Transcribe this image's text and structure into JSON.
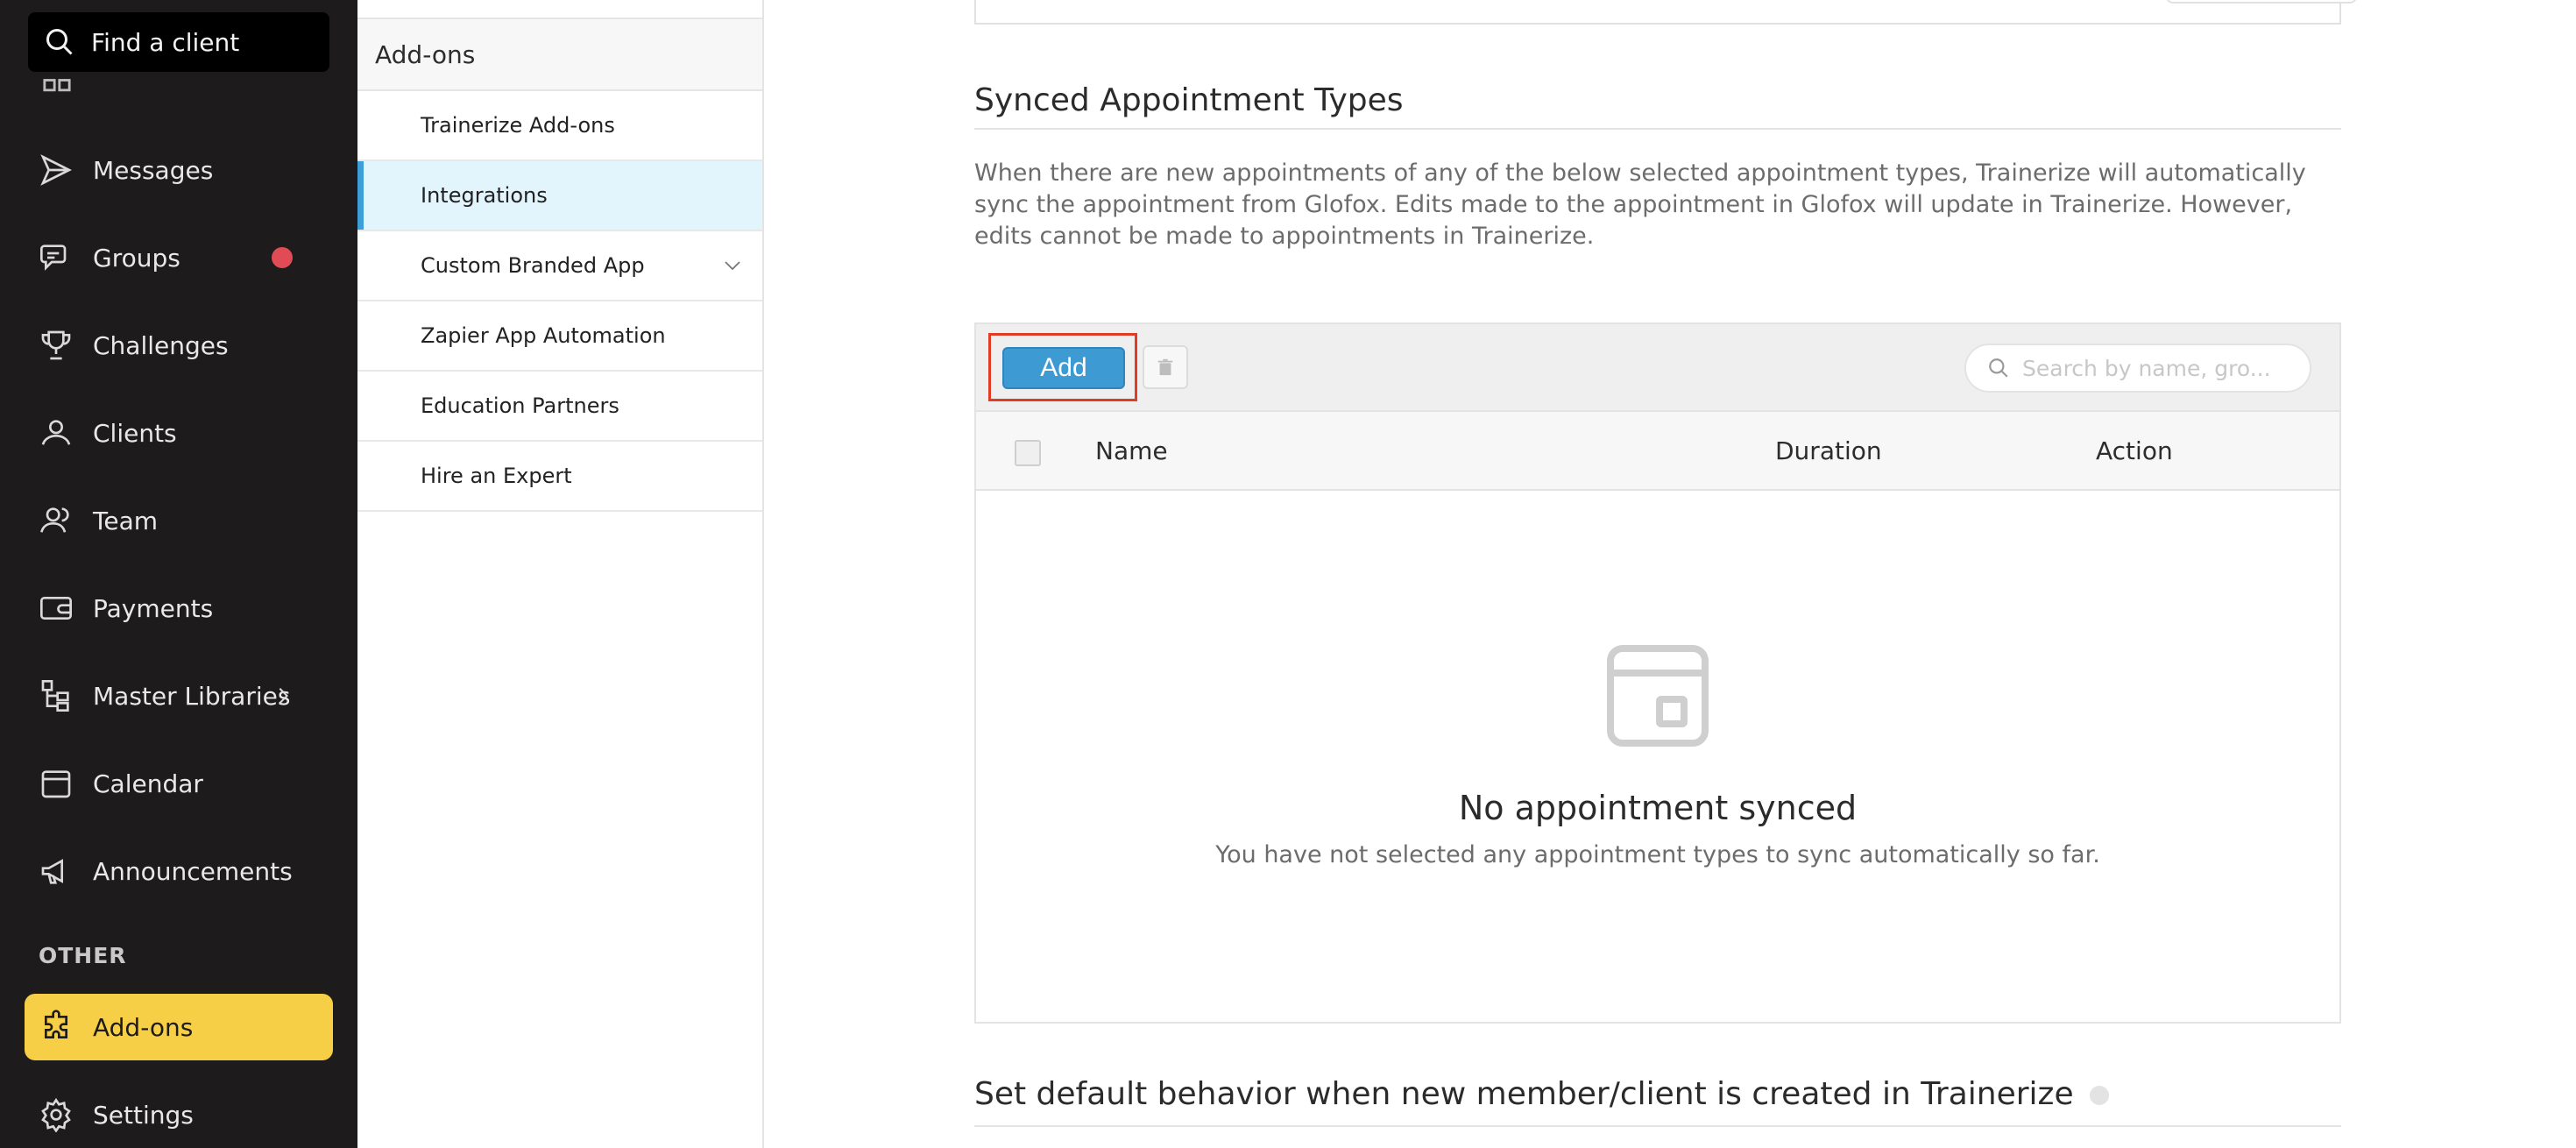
{
  "sidebar": {
    "search_label": "Find a client",
    "items": [
      {
        "label": "Messages",
        "icon": "send-icon"
      },
      {
        "label": "Groups",
        "icon": "chat-group-icon",
        "badge_color": "#e04b55"
      },
      {
        "label": "Challenges",
        "icon": "trophy-icon"
      },
      {
        "label": "Clients",
        "icon": "clients-icon"
      },
      {
        "label": "Team",
        "icon": "team-icon"
      },
      {
        "label": "Payments",
        "icon": "wallet-icon"
      },
      {
        "label": "Master Libraries",
        "icon": "library-icon"
      },
      {
        "label": "Calendar",
        "icon": "calendar-icon"
      },
      {
        "label": "Announcements",
        "icon": "megaphone-icon"
      }
    ],
    "section_other": "OTHER",
    "addons_label": "Add-ons",
    "settings_label": "Settings",
    "active_color": "#f7cf47"
  },
  "submenu": {
    "title": "Add-ons",
    "items": [
      {
        "label": "Trainerize Add-ons"
      },
      {
        "label": "Integrations"
      },
      {
        "label": "Custom Branded App"
      },
      {
        "label": "Zapier App Automation"
      },
      {
        "label": "Education Partners"
      },
      {
        "label": "Hire an Expert"
      }
    ]
  },
  "main": {
    "synced_title": "Synced Appointment Types",
    "description": "When there are new appointments of any of the below selected appointment types, Trainerize will automatically sync the appointment from Glofox. Edits made to the appointment in Glofox will update in Trainerize. However, edits cannot be made to appointments in Trainerize.",
    "add_label": "Add",
    "search_placeholder": "Search by name, gro...",
    "columns": {
      "name": "Name",
      "duration": "Duration",
      "action": "Action"
    },
    "empty_title": "No appointment synced",
    "empty_subtitle": "You have not selected any appointment types to sync automatically so far.",
    "default_behavior_title": "Set default behavior when new member/client is created in Trainerize",
    "accent_color": "#3e9ad3"
  }
}
